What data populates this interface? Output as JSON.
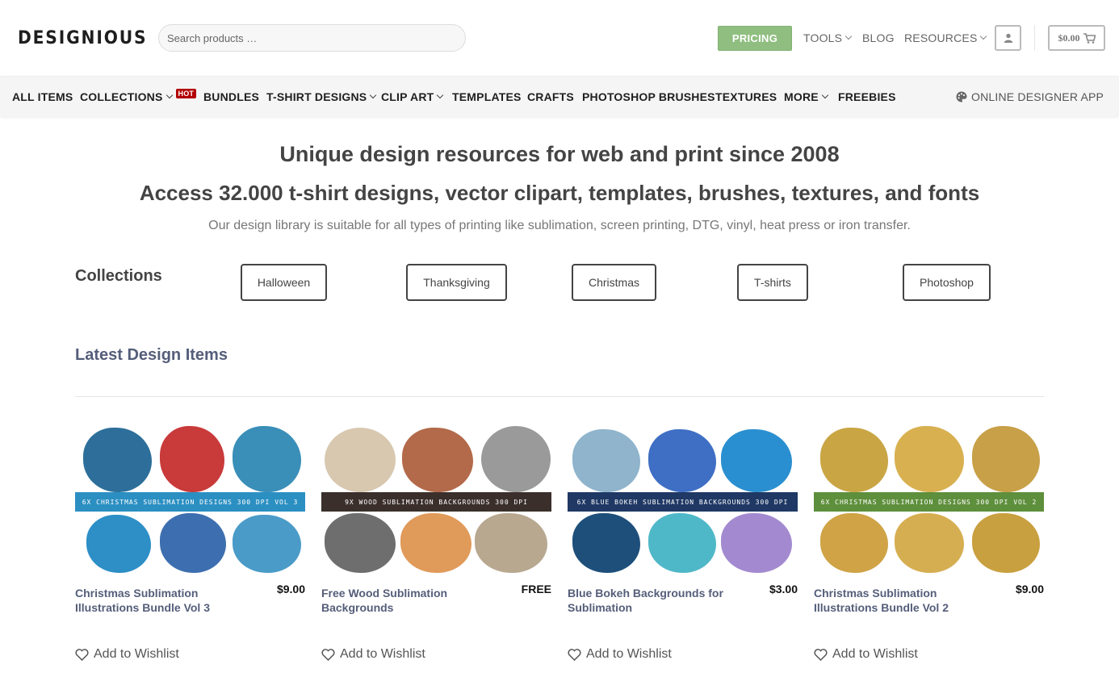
{
  "header": {
    "logo": "DESIGNIOUS",
    "search_placeholder": "Search products …",
    "pricing": "PRICING",
    "tools": "TOOLS",
    "blog": "BLOG",
    "resources": "RESOURCES",
    "cart_total": "$0.00"
  },
  "nav": {
    "items": [
      "ALL ITEMS",
      "COLLECTIONS",
      "BUNDLES",
      "T-SHIRT DESIGNS",
      "CLIP ART",
      "TEMPLATES",
      "CRAFTS",
      "PHOTOSHOP BRUSHES",
      "TEXTURES",
      "MORE",
      "FREEBIES"
    ],
    "hot_badge": "HOT",
    "designer_app": "ONLINE DESIGNER APP"
  },
  "hero": {
    "title": "Unique design resources for web and print since 2008",
    "subtitle": "Access 32.000 t-shirt designs, vector clipart, templates, brushes, textures, and fonts",
    "description": "Our design library is suitable for all types of printing like sublimation, screen printing, DTG, vinyl, heat press or iron transfer."
  },
  "collections": {
    "title": "Collections",
    "buttons": [
      "Halloween",
      "Thanksgiving",
      "Christmas",
      "T-shirts",
      "Photoshop"
    ]
  },
  "latest": {
    "title": "Latest Design Items",
    "products": [
      {
        "title": "Christmas Sublimation Illustrations Bundle Vol 3",
        "price": "$9.00",
        "banner": "6X CHRISTMAS SUBLIMATION DESIGNS 300 DPI VOL 3",
        "wishlist": "Add to Wishlist"
      },
      {
        "title": "Free Wood Sublimation Backgrounds",
        "price": "FREE",
        "banner": "9X WOOD SUBLIMATION BACKGROUNDS 300 DPI",
        "wishlist": "Add to Wishlist"
      },
      {
        "title": "Blue Bokeh Backgrounds for Sublimation",
        "price": "$3.00",
        "banner": "6X BLUE BOKEH SUBLIMATION BACKGROUNDS 300 DPI",
        "wishlist": "Add to Wishlist"
      },
      {
        "title": "Christmas Sublimation Illustrations Bundle Vol 2",
        "price": "$9.00",
        "banner": "6X CHRISTMAS SUBLIMATION DESIGNS 300 DPI VOL 2",
        "wishlist": "Add to Wishlist"
      }
    ]
  },
  "colors": {
    "pricing_green": "#8fbe80",
    "hot_red": "#b20000",
    "link_blue": "#555e7a"
  }
}
